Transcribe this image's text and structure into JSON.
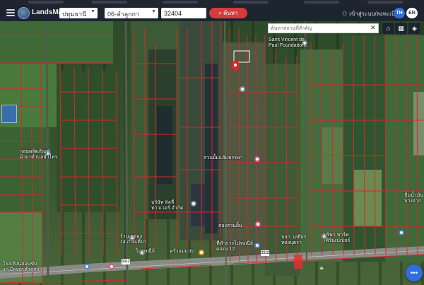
{
  "app": {
    "name": "LandsMaps"
  },
  "filters": {
    "province": "ปทุมธานี",
    "district": "06-ลำลูกกา",
    "parcel_no": "32404",
    "search_label": "ค้นหา"
  },
  "header_right": {
    "login_label": "เข้าสู่ระบบ/ลงทะเบียน",
    "lang_th": "TH",
    "lang_en": "EN"
  },
  "map": {
    "place_search_placeholder": "ค้นหาสถานที่สำคัญ",
    "labels": [
      {
        "text": "Saint Vincent de"
      },
      {
        "text": "Paul Foundation..."
      },
      {
        "text": "กลุ่มผลิตภัณฑ์"
      },
      {
        "text": "ผ้ายาตำบลลำไทร"
      },
      {
        "text": "สวนยิ้มแย้มหรรษา"
      },
      {
        "text": "บริษัท ลิลลี่"
      },
      {
        "text": "ทาวเวอร์ จำกัด"
      },
      {
        "text": "สองสวนยิ้ม"
      },
      {
        "text": "ร้าน คลอง"
      },
      {
        "text": "14 ก๋วยเตี๋ยว"
      },
      {
        "text": "ที่ทำการไปรษณีย์"
      },
      {
        "text": "คลอง 12"
      },
      {
        "text": "ครัวแม่แปป"
      },
      {
        "text": "ไปรษณีย์"
      },
      {
        "text": "บจก. เสถียร"
      },
      {
        "text": "ทองบุตรา"
      },
      {
        "text": "ปริษา หาร์ท"
      },
      {
        "text": "เฟิร์นเปเปอร์"
      },
      {
        "text": "ปั้มน้ำมัน"
      },
      {
        "text": "บางจาก"
      },
      {
        "text": "โรงเรียนสอนขับ"
      },
      {
        "text": "รถ Driver ลำลูกกา"
      }
    ],
    "road_signs": [
      "3312",
      "3312"
    ]
  },
  "colors": {
    "header_bg": "#1c2430",
    "search_btn": "#d43c3c",
    "parcel_line": "#d52a2a",
    "lang_active": "#2d6ee0"
  }
}
